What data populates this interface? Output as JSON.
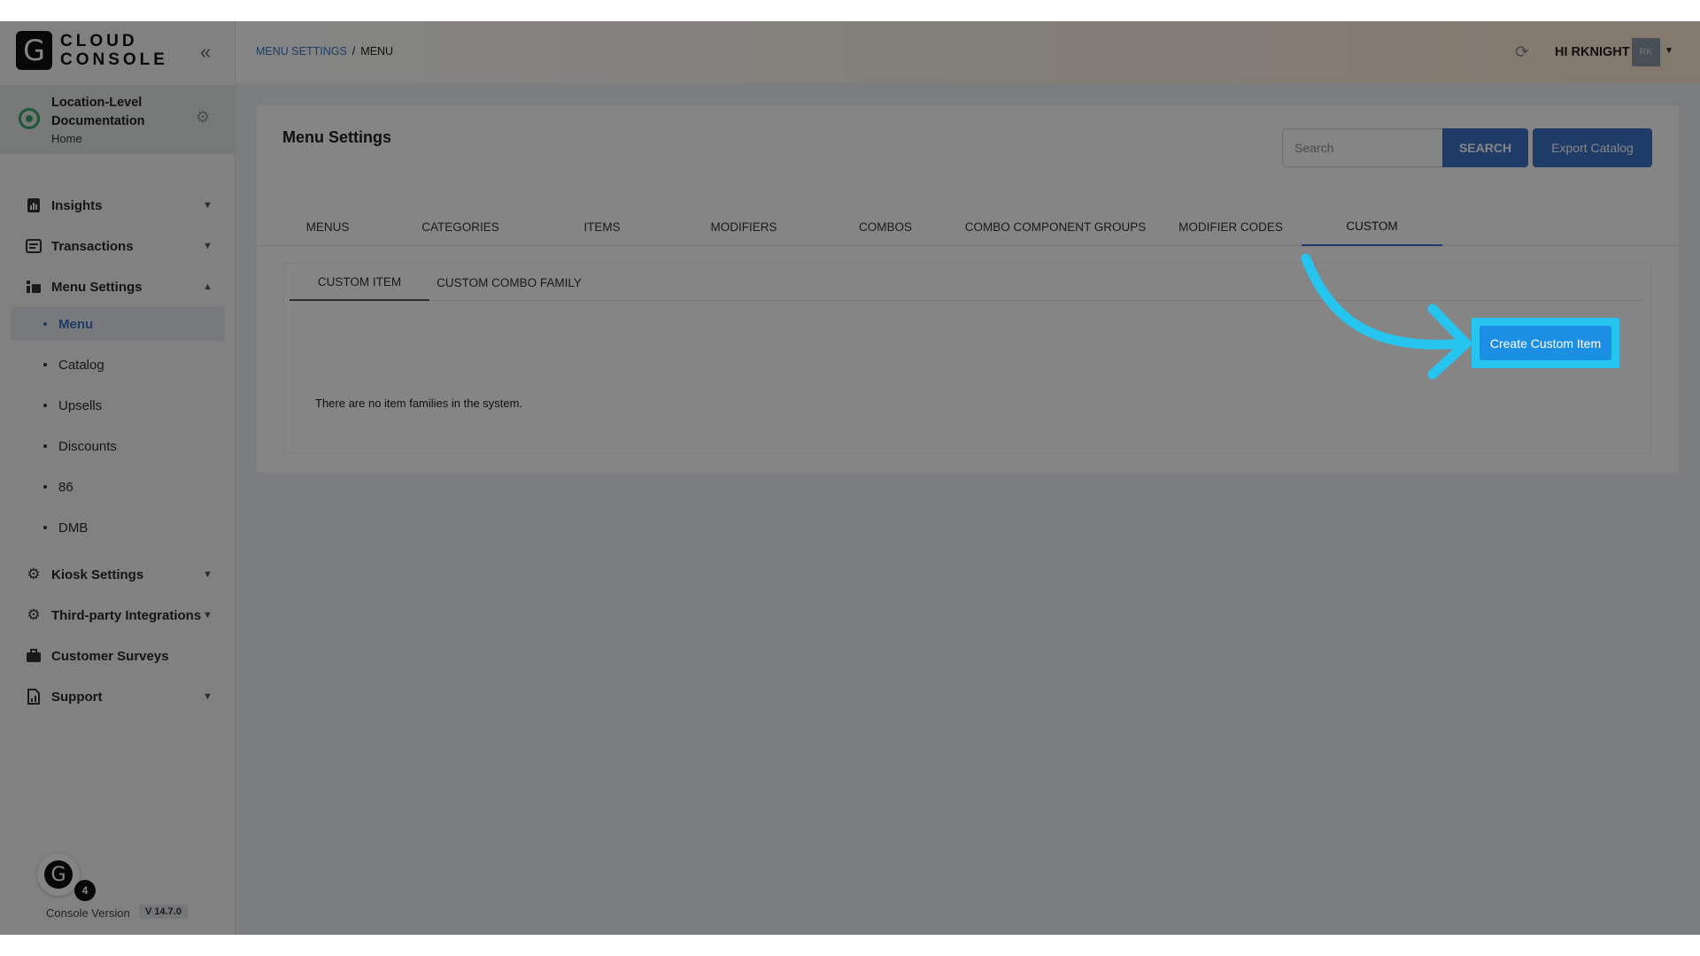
{
  "brand": {
    "mark": "G",
    "line1": "CLOUD",
    "line2": "CONSOLE"
  },
  "location": {
    "name": "Location-Level Documentation",
    "subtitle": "Home"
  },
  "sidebar": {
    "items": [
      {
        "label": "Insights",
        "icon": "chart-report-icon",
        "chevron": "down"
      },
      {
        "label": "Transactions",
        "icon": "receipt-icon",
        "chevron": "down"
      },
      {
        "label": "Menu Settings",
        "icon": "menu-board-icon",
        "chevron": "up"
      },
      {
        "label": "Kiosk Settings",
        "icon": "gear-icon",
        "chevron": "down"
      },
      {
        "label": "Third-party Integrations",
        "icon": "integration-gear-icon",
        "chevron": "down"
      },
      {
        "label": "Customer Surveys",
        "icon": "briefcase-icon",
        "chevron": "none"
      },
      {
        "label": "Support",
        "icon": "document-chart-icon",
        "chevron": "down"
      }
    ],
    "submenu": [
      {
        "label": "Menu",
        "active": true
      },
      {
        "label": "Catalog"
      },
      {
        "label": "Upsells"
      },
      {
        "label": "Discounts"
      },
      {
        "label": "86"
      },
      {
        "label": "DMB"
      }
    ],
    "footer": {
      "badge": "4",
      "console_version_label": "Console Version",
      "version": "V 14.7.0"
    }
  },
  "topbar": {
    "breadcrumb": {
      "parent": "MENU SETTINGS",
      "separator": "/",
      "current": "MENU"
    },
    "greeting": "HI RKNIGHT",
    "avatar_initials": "RK"
  },
  "main": {
    "title": "Menu Settings",
    "search": {
      "placeholder": "Search",
      "value": "",
      "button": "SEARCH"
    },
    "export_button": "Export Catalog",
    "tabs": [
      {
        "label": "MENUS"
      },
      {
        "label": "CATEGORIES"
      },
      {
        "label": "ITEMS"
      },
      {
        "label": "MODIFIERS"
      },
      {
        "label": "COMBOS"
      },
      {
        "label": "COMBO COMPONENT GROUPS"
      },
      {
        "label": "MODIFIER CODES"
      },
      {
        "label": "CUSTOM",
        "active": true
      }
    ],
    "subtabs": [
      {
        "label": "CUSTOM ITEM",
        "active": true
      },
      {
        "label": "CUSTOM COMBO FAMILY"
      }
    ],
    "create_button": "Create Custom Item",
    "empty_message": "There are no item families in the system."
  },
  "colors": {
    "accent": "#3d73c9",
    "highlight": "#25c5f0",
    "create_button": "#1a8fe3",
    "location_pin": "#3ba86a"
  }
}
